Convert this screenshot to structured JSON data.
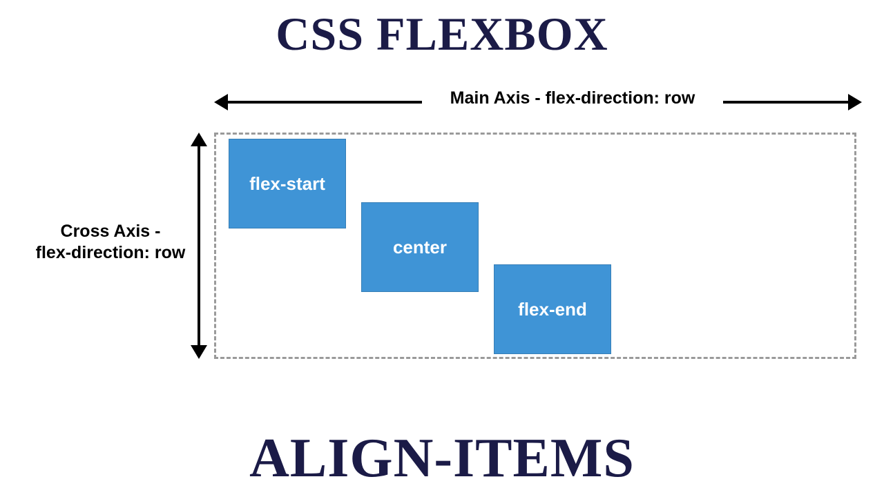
{
  "title_top": "CSS FLEXBOX",
  "title_bottom": "ALIGN-ITEMS",
  "main_axis_label": "Main Axis - flex-direction: row",
  "cross_axis_label_line1": "Cross Axis -",
  "cross_axis_label_line2": "flex-direction: row",
  "items": {
    "a": "flex-start",
    "b": "center",
    "c": "flex-end"
  }
}
